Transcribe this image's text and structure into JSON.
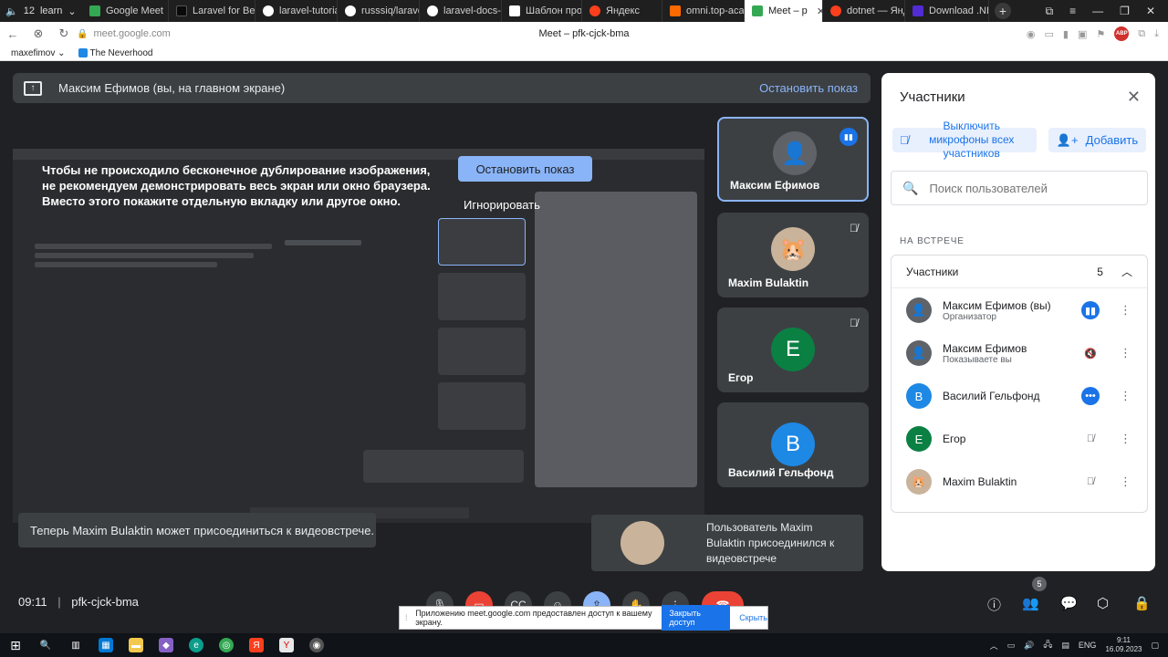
{
  "browser": {
    "tab_group": {
      "count": "12",
      "label": "learn"
    },
    "tabs": [
      {
        "label": "Google Meet",
        "color": "#34a853"
      },
      {
        "label": "Laravel for Beg",
        "color": "#0a0a0a"
      },
      {
        "label": "laravel-tutorial",
        "color": "#ffffff"
      },
      {
        "label": "russsiq/laravel",
        "color": "#ffffff"
      },
      {
        "label": "laravel-docs-ru",
        "color": "#ffffff"
      },
      {
        "label": "Шаблон проек",
        "color": "#ffffff"
      },
      {
        "label": "Яндекс",
        "color": "#fc3f1d"
      },
      {
        "label": "omni.top-acad",
        "color": "#ff6a00"
      },
      {
        "label": "Meet – p",
        "color": "#34a853",
        "active": true
      },
      {
        "label": "dotnet — Янд",
        "color": "#fc3f1d"
      },
      {
        "label": "Download .NET",
        "color": "#512bd4"
      }
    ],
    "url": "meet.google.com",
    "page_title": "Meet – pfk-cjck-bma",
    "bookmarks": [
      {
        "label": "maxefimov"
      },
      {
        "label": "The Neverhood"
      }
    ]
  },
  "meet": {
    "banner": {
      "text": "Максим Ефимов (вы, на главном экране)",
      "stop_label": "Остановить показ"
    },
    "warning": {
      "text": "Чтобы не происходило бесконечное дублирование изображения, не рекомендуем демонстрировать весь экран или окно браузера. Вместо этого покажите отдельную вкладку или другое окно.",
      "stop_button": "Остановить показ",
      "ignore_label": "Игнорировать"
    },
    "tiles": [
      {
        "name": "Максим Ефимов",
        "initial": "",
        "color": "#5f6368",
        "speaking": true
      },
      {
        "name": "Maxim Bulaktin",
        "initial": "",
        "color": "#c9b39a",
        "muted": true
      },
      {
        "name": "Егор",
        "initial": "E",
        "color": "#0b8043",
        "muted": true
      },
      {
        "name": "Василий Гельфонд",
        "initial": "B",
        "color": "#1e88e5"
      }
    ],
    "toast_left": "Теперь Maxim Bulaktin может присоединиться к видеовстрече.",
    "toast_right": "Пользователь Maxim Bulaktin присоединился к видеовстрече",
    "clock": "09:11",
    "meeting_code": "pfk-cjck-bma",
    "people_badge": "5"
  },
  "people": {
    "title": "Участники",
    "mute_all_label": "Выключить микрофоны всех участников",
    "add_label": "Добавить",
    "search_placeholder": "Поиск пользователей",
    "section_label": "НА ВСТРЕЧЕ",
    "group_label": "Участники",
    "group_count": "5",
    "participants": [
      {
        "name": "Максим Ефимов (вы)",
        "sub": "Организатор",
        "initial": "",
        "color": "#5f6368",
        "status": "speaking"
      },
      {
        "name": "Максим Ефимов",
        "sub": "Показываете вы",
        "initial": "",
        "color": "#5f6368",
        "status": "muted"
      },
      {
        "name": "Василий Гельфонд",
        "sub": "",
        "initial": "B",
        "color": "#1e88e5",
        "status": "more"
      },
      {
        "name": "Егор",
        "sub": "",
        "initial": "E",
        "color": "#0b8043",
        "status": "muted"
      },
      {
        "name": "Maxim Bulaktin",
        "sub": "",
        "initial": "",
        "color": "#c9b39a",
        "status": "muted"
      }
    ]
  },
  "share_notice": {
    "message": "Приложению meet.google.com предоставлен доступ к вашему экрану.",
    "stop_label": "Закрыть доступ",
    "hide_label": "Скрыть"
  },
  "taskbar": {
    "lang": "ENG",
    "time": "9:11",
    "date": "16.09.2023"
  },
  "colors": {
    "accent": "#8ab4f8",
    "blue": "#1a73e8",
    "danger": "#ea4335",
    "surface": "#3c4043"
  }
}
